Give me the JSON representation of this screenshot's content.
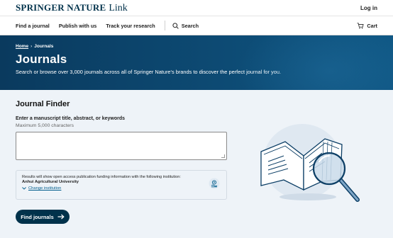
{
  "header": {
    "brand": "SPRINGER NATURE",
    "brand_suffix": "Link",
    "login_label": "Log in"
  },
  "nav": {
    "items": [
      "Find a journal",
      "Publish with us",
      "Track your research"
    ],
    "search_label": "Search",
    "cart_label": "Cart"
  },
  "hero": {
    "breadcrumb_home": "Home",
    "breadcrumb_sep": "›",
    "breadcrumb_current": "Journals",
    "title": "Journals",
    "subtitle": "Search or browse over 3,000 journals across all of Springer Nature's brands to discover the perfect journal for you."
  },
  "finder": {
    "title": "Journal Finder",
    "field_label": "Enter a manuscript title, abstract, or keywords",
    "field_hint": "Maximum 5,000 characters",
    "textarea_value": "",
    "info_line": "Results will show open access publication funding information with the following institution:",
    "institution": "Anhui Agricultural University",
    "change_label": "Change institution",
    "submit_label": "Find journals"
  },
  "colors": {
    "brand_dark": "#01324b",
    "hero_bg": "#0d4a73",
    "link": "#025e8d",
    "page_bg": "#eef3f8"
  }
}
